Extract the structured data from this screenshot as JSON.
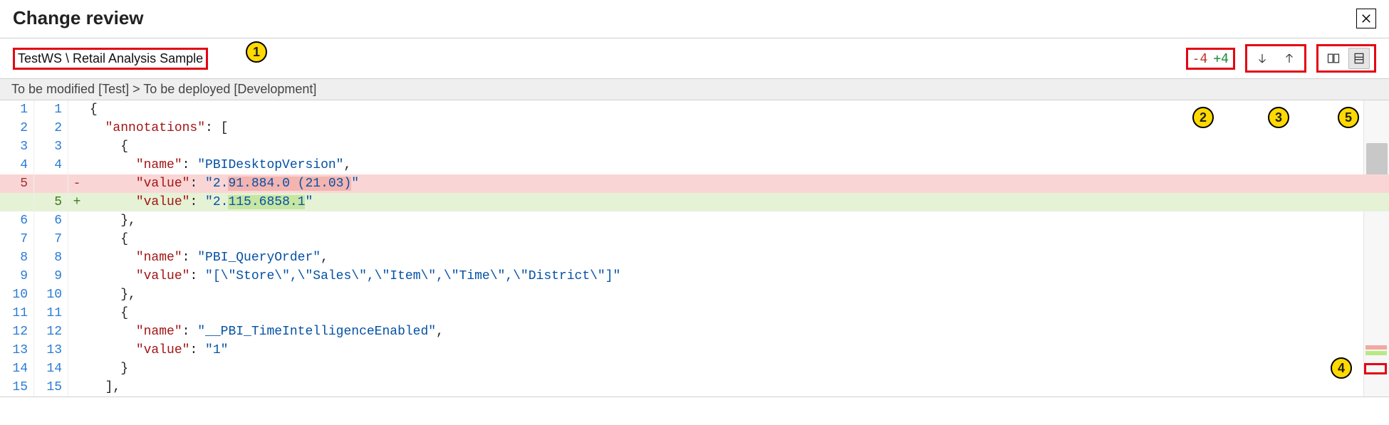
{
  "header": {
    "title": "Change review"
  },
  "toolbar": {
    "breadcrumb": "TestWS \\ Retail Analysis Sample",
    "count_minus": "-4",
    "count_plus": "+4"
  },
  "subheader": {
    "text": "To be modified [Test] > To be deployed [Development]"
  },
  "callouts": [
    "1",
    "2",
    "3",
    "4",
    "5"
  ],
  "diff": {
    "rows": [
      {
        "left": "1",
        "right": "1",
        "sign": "",
        "state": "context",
        "tokens": [
          [
            "brace",
            "{"
          ]
        ]
      },
      {
        "left": "2",
        "right": "2",
        "sign": "",
        "state": "context",
        "tokens": [
          [
            "plain",
            "  "
          ],
          [
            "key",
            "\"annotations\""
          ],
          [
            "plain",
            ": ["
          ]
        ]
      },
      {
        "left": "3",
        "right": "3",
        "sign": "",
        "state": "context",
        "tokens": [
          [
            "plain",
            "    "
          ],
          [
            "brace",
            "{"
          ]
        ]
      },
      {
        "left": "4",
        "right": "4",
        "sign": "",
        "state": "context",
        "tokens": [
          [
            "plain",
            "      "
          ],
          [
            "key",
            "\"name\""
          ],
          [
            "plain",
            ": "
          ],
          [
            "str",
            "\"PBIDesktopVersion\""
          ],
          [
            "plain",
            ","
          ]
        ]
      },
      {
        "left": "5",
        "right": "",
        "sign": "-",
        "state": "removed",
        "tokens": [
          [
            "plain",
            "      "
          ],
          [
            "key",
            "\"value\""
          ],
          [
            "plain",
            ": "
          ],
          [
            "str",
            "\"2."
          ],
          [
            "str-hl",
            "91.884.0 (21.03)"
          ],
          [
            "str",
            "\""
          ]
        ]
      },
      {
        "left": "",
        "right": "5",
        "sign": "+",
        "state": "added",
        "tokens": [
          [
            "plain",
            "      "
          ],
          [
            "key",
            "\"value\""
          ],
          [
            "plain",
            ": "
          ],
          [
            "str",
            "\"2."
          ],
          [
            "str-hl",
            "115.6858.1"
          ],
          [
            "str",
            "\""
          ]
        ]
      },
      {
        "left": "6",
        "right": "6",
        "sign": "",
        "state": "context",
        "tokens": [
          [
            "plain",
            "    "
          ],
          [
            "brace",
            "}"
          ],
          [
            "plain",
            ","
          ]
        ]
      },
      {
        "left": "7",
        "right": "7",
        "sign": "",
        "state": "context",
        "tokens": [
          [
            "plain",
            "    "
          ],
          [
            "brace",
            "{"
          ]
        ]
      },
      {
        "left": "8",
        "right": "8",
        "sign": "",
        "state": "context",
        "tokens": [
          [
            "plain",
            "      "
          ],
          [
            "key",
            "\"name\""
          ],
          [
            "plain",
            ": "
          ],
          [
            "str",
            "\"PBI_QueryOrder\""
          ],
          [
            "plain",
            ","
          ]
        ]
      },
      {
        "left": "9",
        "right": "9",
        "sign": "",
        "state": "context",
        "tokens": [
          [
            "plain",
            "      "
          ],
          [
            "key",
            "\"value\""
          ],
          [
            "plain",
            ": "
          ],
          [
            "str",
            "\"[\\\"Store\\\",\\\"Sales\\\",\\\"Item\\\",\\\"Time\\\",\\\"District\\\"]\""
          ]
        ]
      },
      {
        "left": "10",
        "right": "10",
        "sign": "",
        "state": "context",
        "tokens": [
          [
            "plain",
            "    "
          ],
          [
            "brace",
            "}"
          ],
          [
            "plain",
            ","
          ]
        ]
      },
      {
        "left": "11",
        "right": "11",
        "sign": "",
        "state": "context",
        "tokens": [
          [
            "plain",
            "    "
          ],
          [
            "brace",
            "{"
          ]
        ]
      },
      {
        "left": "12",
        "right": "12",
        "sign": "",
        "state": "context",
        "tokens": [
          [
            "plain",
            "      "
          ],
          [
            "key",
            "\"name\""
          ],
          [
            "plain",
            ": "
          ],
          [
            "str",
            "\"__PBI_TimeIntelligenceEnabled\""
          ],
          [
            "plain",
            ","
          ]
        ]
      },
      {
        "left": "13",
        "right": "13",
        "sign": "",
        "state": "context",
        "tokens": [
          [
            "plain",
            "      "
          ],
          [
            "key",
            "\"value\""
          ],
          [
            "plain",
            ": "
          ],
          [
            "str",
            "\"1\""
          ]
        ]
      },
      {
        "left": "14",
        "right": "14",
        "sign": "",
        "state": "context",
        "tokens": [
          [
            "plain",
            "    "
          ],
          [
            "brace",
            "}"
          ]
        ]
      },
      {
        "left": "15",
        "right": "15",
        "sign": "",
        "state": "context",
        "tokens": [
          [
            "plain",
            "  "
          ],
          [
            "plain",
            "],"
          ]
        ]
      }
    ]
  }
}
